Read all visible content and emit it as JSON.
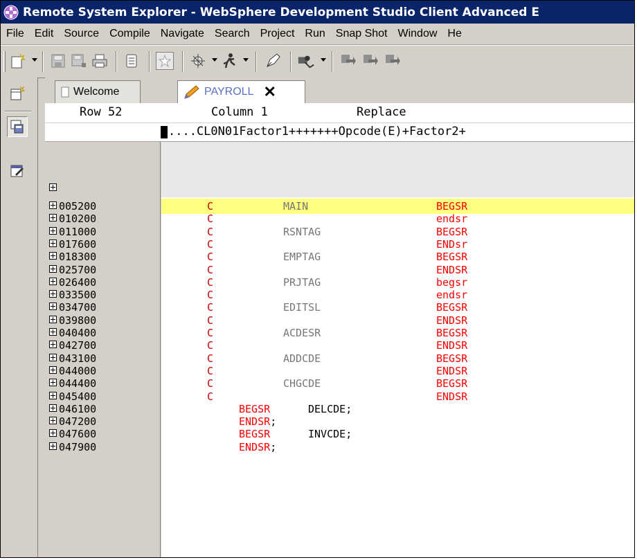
{
  "window": {
    "title": "Remote System Explorer - WebSphere Development Studio Client Advanced E"
  },
  "menu": [
    "File",
    "Edit",
    "Source",
    "Compile",
    "Navigate",
    "Search",
    "Project",
    "Run",
    "Snap Shot",
    "Window",
    "He"
  ],
  "tabs": {
    "welcome": "Welcome",
    "payroll": "PAYROLL",
    "close_glyph": "✕"
  },
  "status": {
    "row": "Row 52",
    "column": "Column 1",
    "mode": "Replace"
  },
  "ruler": "....CL0N01Factor1+++++++Opcode(E)+Factor2+",
  "fixed_rows": [
    {
      "seq": "005200",
      "spec": "C",
      "factor": "MAIN",
      "opcode": "BEGSR",
      "highlight": true
    },
    {
      "seq": "010200",
      "spec": "C",
      "factor": "",
      "opcode": "endsr"
    },
    {
      "seq": "011000",
      "spec": "C",
      "factor": "RSNTAG",
      "opcode": "BEGSR"
    },
    {
      "seq": "017600",
      "spec": "C",
      "factor": "",
      "opcode": "ENDsr"
    },
    {
      "seq": "018300",
      "spec": "C",
      "factor": "EMPTAG",
      "opcode": "BEGSR"
    },
    {
      "seq": "025700",
      "spec": "C",
      "factor": "",
      "opcode": "ENDSR"
    },
    {
      "seq": "026400",
      "spec": "C",
      "factor": "PRJTAG",
      "opcode": "begsr"
    },
    {
      "seq": "033500",
      "spec": "C",
      "factor": "",
      "opcode": "endsr"
    },
    {
      "seq": "034700",
      "spec": "C",
      "factor": "EDITSL",
      "opcode": "BEGSR"
    },
    {
      "seq": "039800",
      "spec": "C",
      "factor": "",
      "opcode": "ENDSR"
    },
    {
      "seq": "040400",
      "spec": "C",
      "factor": "ACDESR",
      "opcode": "BEGSR"
    },
    {
      "seq": "042700",
      "spec": "C",
      "factor": "",
      "opcode": "ENDSR"
    },
    {
      "seq": "043100",
      "spec": "C",
      "factor": "ADDCDE",
      "opcode": "BEGSR"
    },
    {
      "seq": "044000",
      "spec": "C",
      "factor": "",
      "opcode": "ENDSR"
    },
    {
      "seq": "044400",
      "spec": "C",
      "factor": "CHGCDE",
      "opcode": "BEGSR"
    },
    {
      "seq": "045400",
      "spec": "C",
      "factor": "",
      "opcode": "ENDSR"
    }
  ],
  "free_rows": [
    {
      "seq": "046100",
      "op": "BEGSR",
      "arg": "DELCDE",
      "semi": ";"
    },
    {
      "seq": "047200",
      "op": "ENDSR",
      "arg": "",
      "semi": ";"
    },
    {
      "seq": "047600",
      "op": "BEGSR",
      "arg": "INVCDE",
      "semi": ";"
    },
    {
      "seq": "047900",
      "op": "ENDSR",
      "arg": "",
      "semi": ";"
    }
  ],
  "toolbar_icons": [
    "new-wizard-icon",
    "save-icon",
    "save-all-icon",
    "print-icon",
    "properties-icon",
    "bookmark-icon",
    "debug-icon",
    "run-icon",
    "pen-icon",
    "external-tools-icon",
    "previous-annotation-icon",
    "next-annotation-icon",
    "last-edit-icon"
  ],
  "perspective_icons": [
    "open-perspective-icon",
    "rse-perspective-icon",
    "edit-perspective-icon"
  ],
  "colors": {
    "titlebar": "#0a246a",
    "highlight_row": "#ffff80",
    "keyword": "#ff0000",
    "spec": "#cc0000",
    "factor": "#777777"
  }
}
